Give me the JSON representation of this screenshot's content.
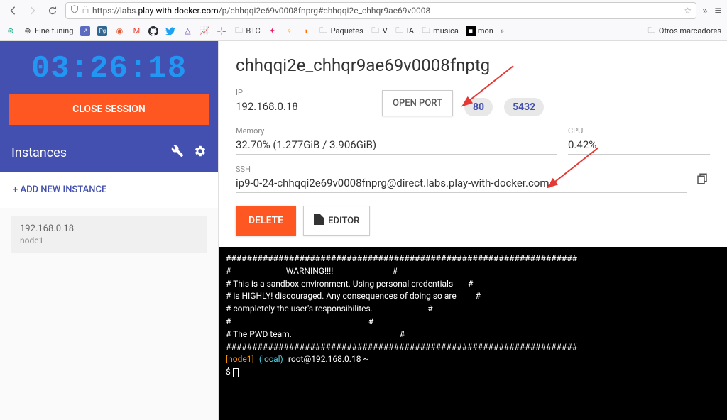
{
  "browser": {
    "url_prefix": "https://labs.",
    "url_domain": "play-with-docker.com",
    "url_path": "/p/chhqqi2e69v0008fnprg#chhqqi2e_chhqr9ae69v0008"
  },
  "bookmarks": {
    "fine_tuning": "Fine-tuning",
    "btc": "BTC",
    "paquetes": "Paquetes",
    "v": "V",
    "ia": "IA",
    "musica": "musica",
    "mon": "mon",
    "otros": "Otros marcadores"
  },
  "sidebar": {
    "timer": "03:26:18",
    "close_session": "CLOSE SESSION",
    "instances_title": "Instances",
    "add_instance": "+ ADD NEW INSTANCE",
    "instance": {
      "ip": "192.168.0.18",
      "name": "node1"
    }
  },
  "panel": {
    "title": "chhqqi2e_chhqr9ae69v0008fnptg",
    "ip_label": "IP",
    "ip_value": "192.168.0.18",
    "open_port": "OPEN PORT",
    "port1": "80",
    "port2": "5432",
    "memory_label": "Memory",
    "memory_value": "32.70% (1.277GiB / 3.906GiB)",
    "cpu_label": "CPU",
    "cpu_value": "0.42%",
    "ssh_label": "SSH",
    "ssh_value": "ip9-0-24-chhqqi2e69v0008fnprg@direct.labs.play-with-docker.com",
    "delete": "DELETE",
    "editor": "EDITOR"
  },
  "terminal": {
    "line1": "###################################################################",
    "line2": "#                          WARNING!!!!                            #",
    "line3": "# This is a sandbox environment. Using personal credentials       #",
    "line4": "# is HIGHLY! discouraged. Any consequences of doing so are         #",
    "line5": "# completely the user's responsibilites.                          #",
    "line6": "#                                                                 #",
    "line7": "# The PWD team.                                                   #",
    "line8": "###################################################################",
    "prompt_node": "[node1]",
    "prompt_local": "(local)",
    "prompt_user": "root@192.168.0.18 ~",
    "prompt_dollar": "$ "
  }
}
